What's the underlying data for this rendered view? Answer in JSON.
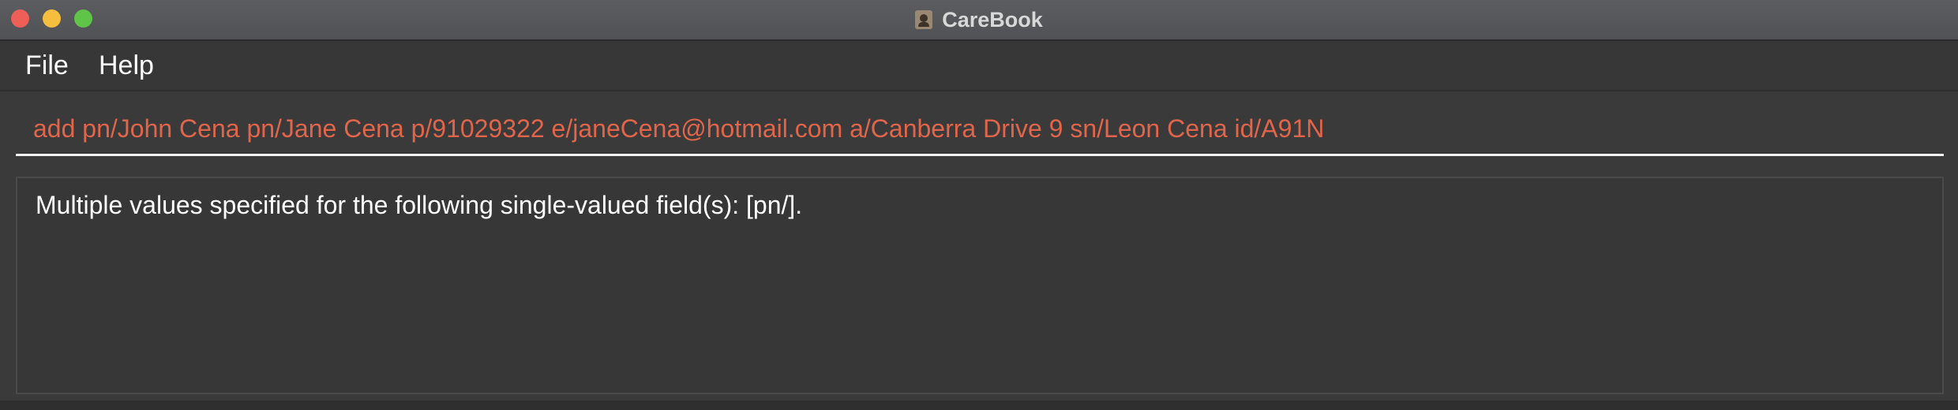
{
  "window": {
    "title": "CareBook",
    "app_icon": "address-book-icon"
  },
  "menu": {
    "items": [
      {
        "label": "File"
      },
      {
        "label": "Help"
      }
    ]
  },
  "command_box": {
    "value": "add pn/John Cena pn/Jane Cena p/91029322 e/janeCena@hotmail.com a/Canberra Drive 9 sn/Leon Cena id/A91N",
    "text_color": "#e0654b"
  },
  "result_display": {
    "text": "Multiple values specified for the following single-valued field(s): [pn/]."
  },
  "colors": {
    "close": "#ee5f57",
    "minimize": "#f5be3f",
    "maximize": "#5fc448",
    "background": "#3a3a3a"
  }
}
